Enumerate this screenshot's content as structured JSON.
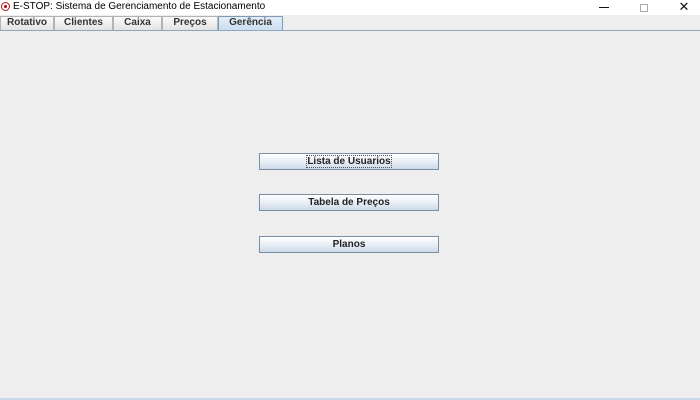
{
  "window": {
    "title": "E-STOP: Sistema de Gerenciamento de Estacionamento",
    "controls": {
      "minimize_icon": "minimize-icon",
      "maximize_icon": "maximize-icon",
      "close_icon": "close-icon",
      "close_glyph": "✕"
    }
  },
  "tabs": [
    {
      "label": "Rotativo",
      "selected": false
    },
    {
      "label": "Clientes",
      "selected": false
    },
    {
      "label": "Caixa",
      "selected": false
    },
    {
      "label": "Preços",
      "selected": false
    },
    {
      "label": "Gerência",
      "selected": true
    }
  ],
  "main": {
    "buttons": [
      {
        "label": "Lista de Usuarios",
        "focused": true
      },
      {
        "label": "Tabela de Preços",
        "focused": false
      },
      {
        "label": "Planos",
        "focused": false
      }
    ]
  },
  "colors": {
    "background": "#eeeeee",
    "selected_tab": "#c9dcef",
    "button_border": "#7a8ea3",
    "app_icon": "#b01818"
  }
}
